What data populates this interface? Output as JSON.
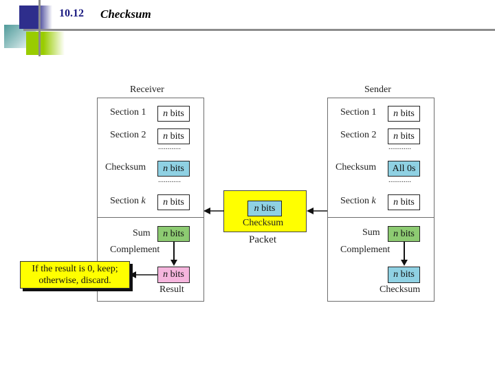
{
  "slide": {
    "number": "10.12",
    "title": "Checksum"
  },
  "receiver": {
    "title": "Receiver",
    "rows": [
      {
        "label": "Section 1",
        "value_var": "n",
        "value_text": " bits",
        "color": "white"
      },
      {
        "label": "Section 2",
        "value_var": "n",
        "value_text": " bits",
        "color": "white"
      },
      {
        "label": "Checksum",
        "value_var": "n",
        "value_text": " bits",
        "color": "blue"
      },
      {
        "label": "Section ",
        "label_var": "k",
        "value_var": "n",
        "value_text": " bits",
        "color": "white"
      }
    ],
    "dots": "............",
    "sum_label": "Sum",
    "sum_box": {
      "value_var": "n",
      "value_text": " bits"
    },
    "complement_label": "Complement",
    "result_box": {
      "value_var": "n",
      "value_text": " bits"
    },
    "result_label": "Result",
    "note_line1": "If the result is 0, keep;",
    "note_line2": "otherwise, discard."
  },
  "packet": {
    "box": {
      "value_var": "n",
      "value_text": " bits"
    },
    "inner_label": "Checksum",
    "label": "Packet"
  },
  "sender": {
    "title": "Sender",
    "rows": [
      {
        "label": "Section 1",
        "value_var": "n",
        "value_text": " bits",
        "color": "white"
      },
      {
        "label": "Section 2",
        "value_var": "n",
        "value_text": " bits",
        "color": "white"
      },
      {
        "label": "Checksum",
        "value_plain": "All 0s",
        "color": "blue"
      },
      {
        "label": "Section ",
        "label_var": "k",
        "value_var": "n",
        "value_text": " bits",
        "color": "white"
      }
    ],
    "dots": "............",
    "sum_label": "Sum",
    "sum_box": {
      "value_var": "n",
      "value_text": " bits"
    },
    "complement_label": "Complement",
    "checksum_box": {
      "value_var": "n",
      "value_text": " bits"
    },
    "checksum_label": "Checksum"
  },
  "colors": {
    "checksum_blue": "#8fd1e3",
    "sum_green": "#8dcb72",
    "result_pink": "#f5b5dd",
    "packet_yellow": "#ffff00"
  }
}
